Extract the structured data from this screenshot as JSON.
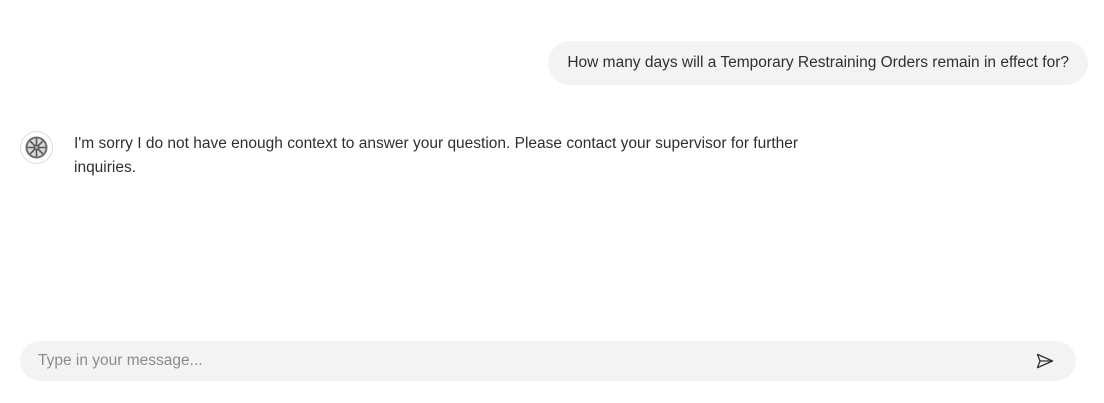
{
  "conversation": {
    "user_message": "How many days will a Temporary Restraining Orders remain in effect for?",
    "bot_message": "I'm sorry I do not have enough context to answer your question. Please contact your supervisor for further inquiries.",
    "bot_avatar_icon": "wheel-logo-icon"
  },
  "composer": {
    "placeholder": "Type in your message...",
    "value": "",
    "send_icon": "send-icon"
  }
}
